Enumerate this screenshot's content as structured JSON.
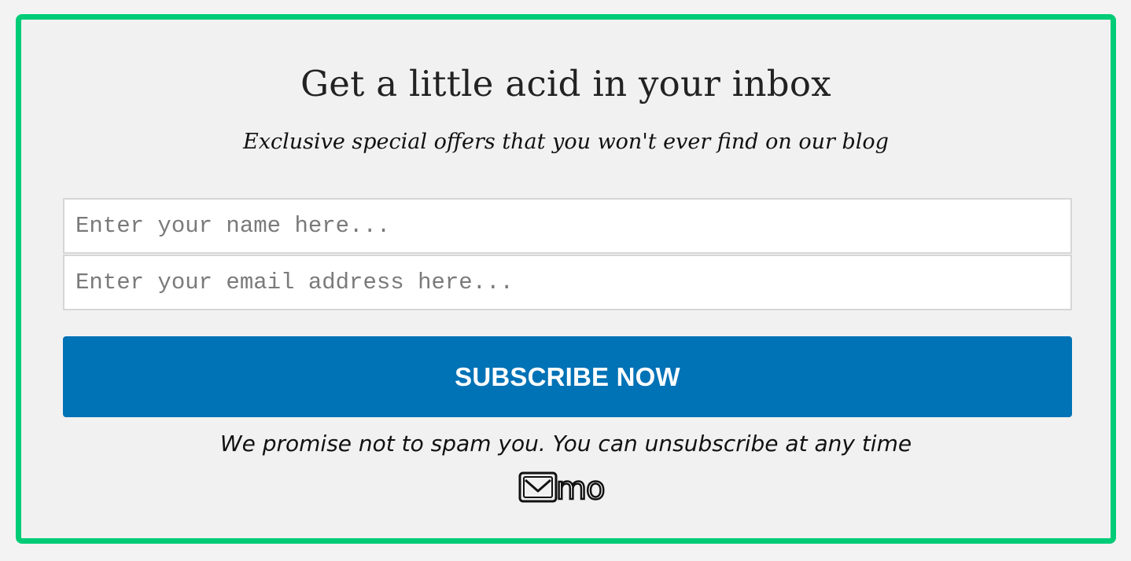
{
  "optin": {
    "headline": "Get a little acid in your inbox",
    "subheadline": "Exclusive special offers that you won't ever find on our blog",
    "name_placeholder": "Enter your name here...",
    "email_placeholder": "Enter your email address here...",
    "button_label": "SUBSCRIBE NOW",
    "disclaimer": "We promise not to spam you. You can unsubscribe at any time",
    "logo_text": "mo"
  },
  "colors": {
    "border_accent": "#00cc77",
    "button_background": "#0072b6",
    "card_background": "#f1f1f1"
  },
  "icons": {
    "logo": "mailmunch-logo-icon"
  }
}
